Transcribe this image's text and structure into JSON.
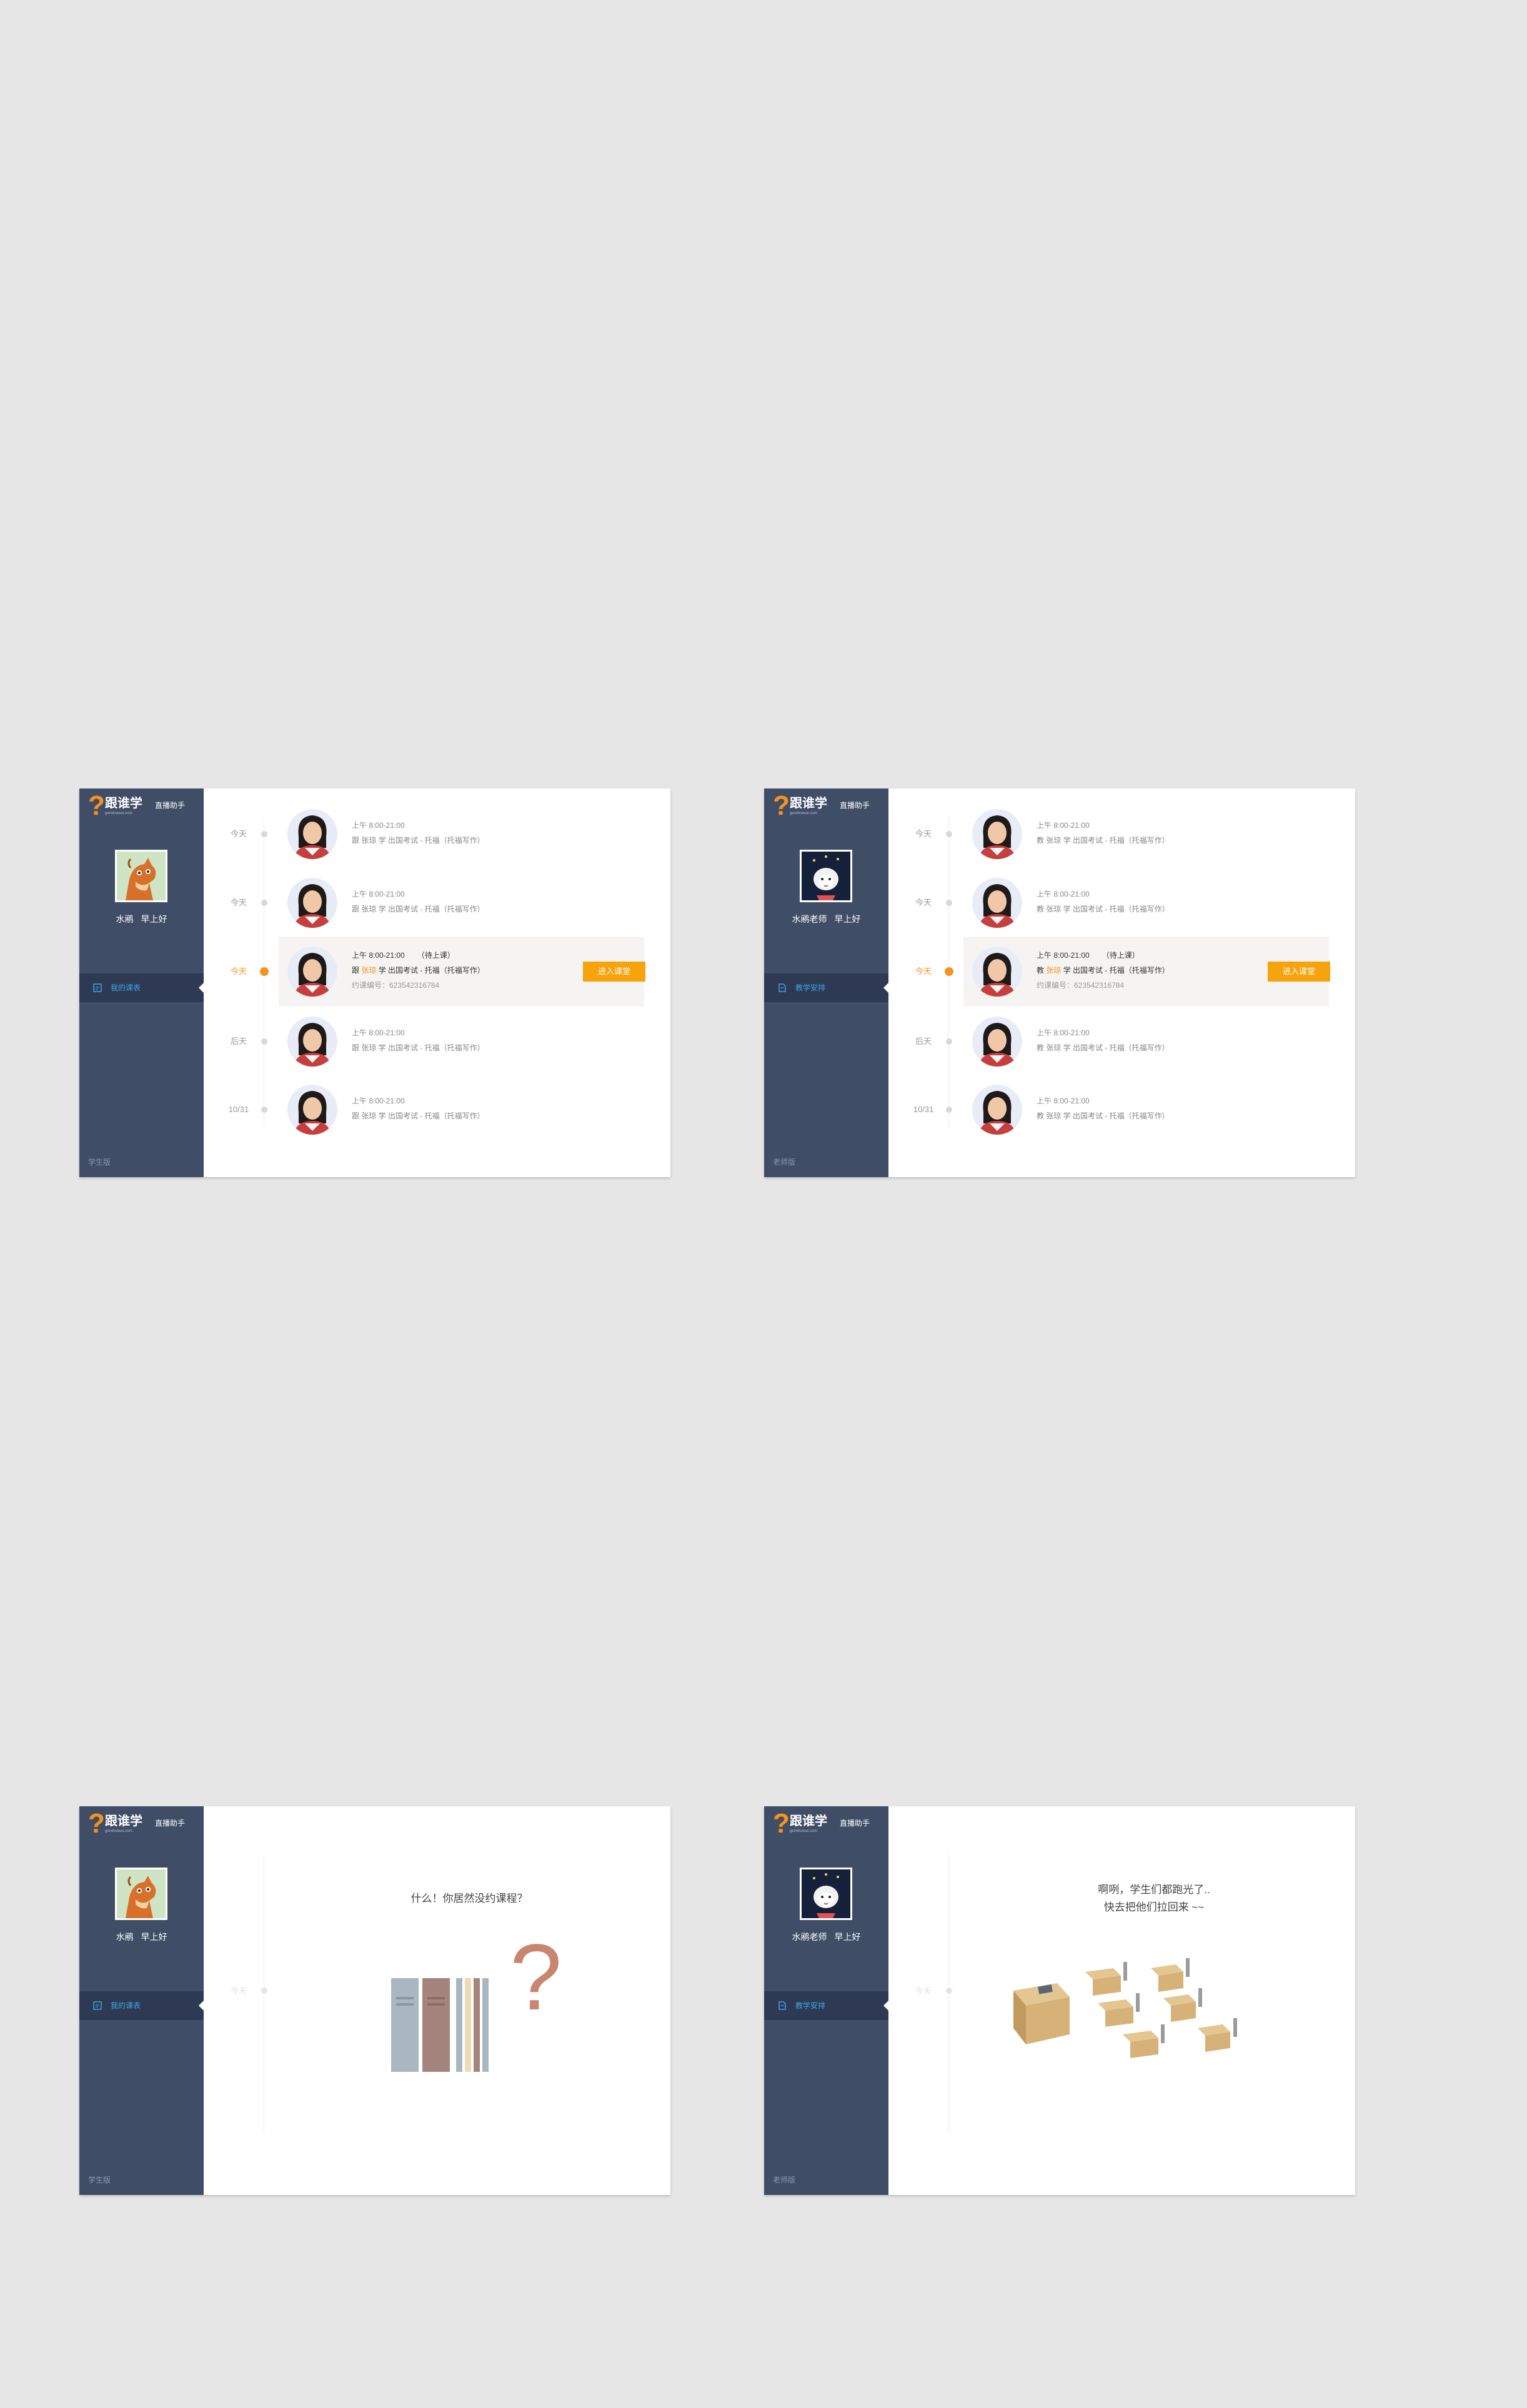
{
  "brand": {
    "name": "跟谁学",
    "sub": "genshuixue.com",
    "tag": "直播助手",
    "accent": "#f7921e"
  },
  "student": {
    "name": "水鹇",
    "greet": "早上好",
    "nav": "我的课表",
    "version": "学生版",
    "avatar": "camel-cartoon-icon"
  },
  "teacher": {
    "name": "水鹇老师",
    "greet": "早上好",
    "nav": "教学安排",
    "version": "老师版",
    "avatar": "sheep-cartoon-icon"
  },
  "schedule_student": [
    {
      "day": "今天",
      "time": "上午  8:00-21:00",
      "line2": "跟 张琼 学 出国考试 - 托福（托福写作）"
    },
    {
      "day": "今天",
      "time": "上午  8:00-21:00",
      "line2": "跟 张琼 学 出国考试 - 托福（托福写作）"
    },
    {
      "day": "今天",
      "time": "上午  8:00-21:00",
      "status": "（待上课）",
      "prefix": "跟",
      "teacher": "张琼",
      "line2rest": "学 出国考试 - 托福（托福写作）",
      "line3": "约课编号：623542316784",
      "button": "进入课堂"
    },
    {
      "day": "后天",
      "time": "上午  8:00-21:00",
      "line2": "跟 张琼 学 出国考试 - 托福（托福写作）"
    },
    {
      "day": "10/31",
      "time": "上午  8:00-21:00",
      "line2": "跟 张琼 学 出国考试 - 托福（托福写作）"
    }
  ],
  "schedule_teacher": [
    {
      "day": "今天",
      "time": "上午  8:00-21:00",
      "line2": "教 张琼 学 出国考试 - 托福（托福写作）"
    },
    {
      "day": "今天",
      "time": "上午  8:00-21:00",
      "line2": "教 张琼 学 出国考试 - 托福（托福写作）"
    },
    {
      "day": "今天",
      "time": "上午  8:00-21:00",
      "status": "（待上课）",
      "prefix": "教",
      "teacher": "张琼",
      "line2rest": "学 出国考试 - 托福（托福写作）",
      "line3": "约课编号：623542316784",
      "button": "进入课堂"
    },
    {
      "day": "后天",
      "time": "上午  8:00-21:00",
      "line2": "教 张琼 学 出国考试 - 托福（托福写作）"
    },
    {
      "day": "10/31",
      "time": "上午  8:00-21:00",
      "line2": "教 张琼 学 出国考试 - 托福（托福写作）"
    }
  ],
  "empty_student": {
    "day": "今天",
    "message": "什么！你居然没约课程？",
    "illustration": "books-question-illustration"
  },
  "empty_teacher": {
    "day": "今天",
    "message_line1": "啊咧，学生们都跑光了..",
    "message_line2": "快去把他们拉回来 ~~",
    "illustration": "empty-classroom-illustration"
  }
}
